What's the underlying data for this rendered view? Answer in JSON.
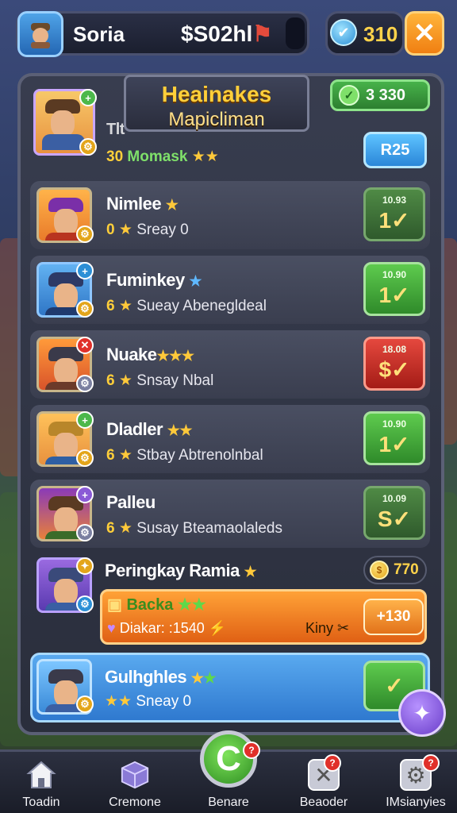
{
  "header": {
    "player_name": "Soria",
    "money": "$S02hl",
    "gem_count": "310",
    "close_glyph": "✕"
  },
  "panel": {
    "title_line1": "Heainakes",
    "title_line2": "Mapicliman",
    "currency_value": "3 330"
  },
  "featured": {
    "name": "Tlt",
    "score": "30",
    "tag": "Momask",
    "button_label": "R25"
  },
  "rows": [
    {
      "name": "Nimlee",
      "stars": "★",
      "score": "0",
      "sub": "Sreay 0",
      "btn_small": "10.93",
      "btn_big": "1✓"
    },
    {
      "name": "Fuminkey",
      "stars": "★",
      "score": "6",
      "sub": "Sueay Abenegldeal",
      "btn_small": "10.90",
      "btn_big": "1✓"
    },
    {
      "name": "Nuake",
      "stars": "★★★",
      "score": "6",
      "sub": "Snsay Nbal",
      "btn_small": "18.08",
      "btn_big": "$✓"
    },
    {
      "name": "Dladler",
      "stars": "★★",
      "score": "6",
      "sub": "Stbay Abtrenolnbal",
      "btn_small": "10.90",
      "btn_big": "1✓"
    },
    {
      "name": "Palleu",
      "stars": "",
      "score": "6",
      "sub": "Susay Bteamaolaleds",
      "btn_small": "10.09",
      "btn_big": "S✓"
    }
  ],
  "ranking_row": {
    "name": "Peringkay Ramia",
    "coin_value": "770",
    "bar_title": "Backa",
    "bar_detail": "Diakar: :1540",
    "bar_right": "Kiny",
    "bar_button": "+130"
  },
  "current_row": {
    "name": "Gulhghles",
    "sub": "Sneay 0"
  },
  "nav": [
    {
      "label": "Toadin"
    },
    {
      "label": "Cremone"
    },
    {
      "label": "Benare"
    },
    {
      "label": "Beaoder"
    },
    {
      "label": "IMsianyies"
    }
  ],
  "colors": {
    "accent_green": "#5ecb4e",
    "accent_orange": "#ffa237",
    "accent_blue": "#2f79cf",
    "gold": "#ffcf3a"
  }
}
